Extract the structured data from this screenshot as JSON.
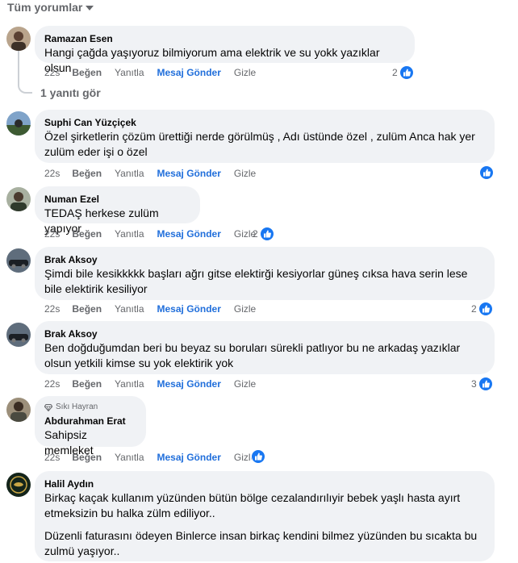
{
  "filter": {
    "label": "Tüm yorumlar"
  },
  "actions": {
    "like": "Beğen",
    "reply": "Yanıtla",
    "send": "Mesaj Gönder",
    "hide": "Gizle"
  },
  "comments": [
    {
      "author": "Ramazan Esen",
      "lines": [
        "Hangi çağda yaşıyoruz bilmiyorum ama elektrik ve su yokk yazıklar olsun"
      ],
      "time": "22s",
      "reactions": "2",
      "replies_label": "1 yanıtı gör"
    },
    {
      "author": "Suphi Can Yüzçiçek",
      "lines": [
        "Özel şirketlerin çözüm ürettiği nerde görülmüş , Adı üstünde özel , zulüm Anca hak yer zulüm eder işi o özel"
      ],
      "time": "22s",
      "reactions": ""
    },
    {
      "author": "Numan Ezel",
      "lines": [
        "TEDAŞ herkese zulüm yapıyor"
      ],
      "time": "22s",
      "reactions": "2"
    },
    {
      "author": "Brak Aksoy",
      "lines": [
        "Şimdi bile kesikkkkk başları ağrı gitse elektirği kesiyorlar güneş cıksa hava serin lese bile elektirik kesiliyor"
      ],
      "time": "22s",
      "reactions": "2"
    },
    {
      "author": "Brak Aksoy",
      "lines": [
        "Ben doğduğumdan beri bu beyaz su boruları sürekli patlıyor bu ne arkadaş yazıklar olsun yetkili kimse su yok elektirik yok"
      ],
      "time": "22s",
      "reactions": "3"
    },
    {
      "badge": "Sıkı Hayran",
      "author": "Abdurahman Erat",
      "lines": [
        "Sahipsiz memleket"
      ],
      "time": "22s",
      "reactions": ""
    },
    {
      "author": "Halil Aydın",
      "lines": [
        "Birkaç kaçak kullanım yüzünden bütün bölge cezalandırılıyir bebek yaşlı hasta ayırt etmeksizin bu halka zülm ediliyor..",
        "Düzenli faturasını ödeyen Binlerce insan birkaç kendini bilmez yüzünden bu sıcakta bu zulmü yaşıyor.."
      ]
    }
  ]
}
